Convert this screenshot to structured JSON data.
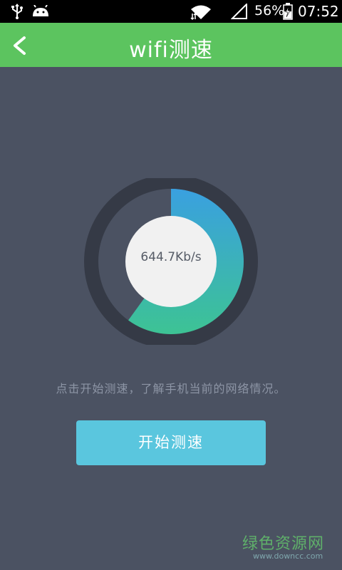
{
  "status_bar": {
    "battery_percent": "56%",
    "time": "07:52",
    "icons": [
      "usb-icon",
      "android-icon",
      "wifi-icon",
      "signal-icon",
      "battery-charging-icon"
    ]
  },
  "header": {
    "title": "wifi测速",
    "back_icon": "chevron-left-icon",
    "background": "#5cc45f"
  },
  "speed_test": {
    "current_speed": "644.7Kb/s",
    "progress_fraction": 0.6,
    "hint": "点击开始测速，了解手机当前的网络情况。",
    "start_button_label": "开始测速",
    "ring_colors": {
      "track": "#353a46",
      "start": "#3aa0e0",
      "end": "#3dc394",
      "center": "#f1f1f1"
    }
  },
  "watermark": {
    "brand": "绿色资源网",
    "url": "www.downcc.com"
  },
  "colors": {
    "background": "#4b5262",
    "button": "#5ac6de"
  }
}
